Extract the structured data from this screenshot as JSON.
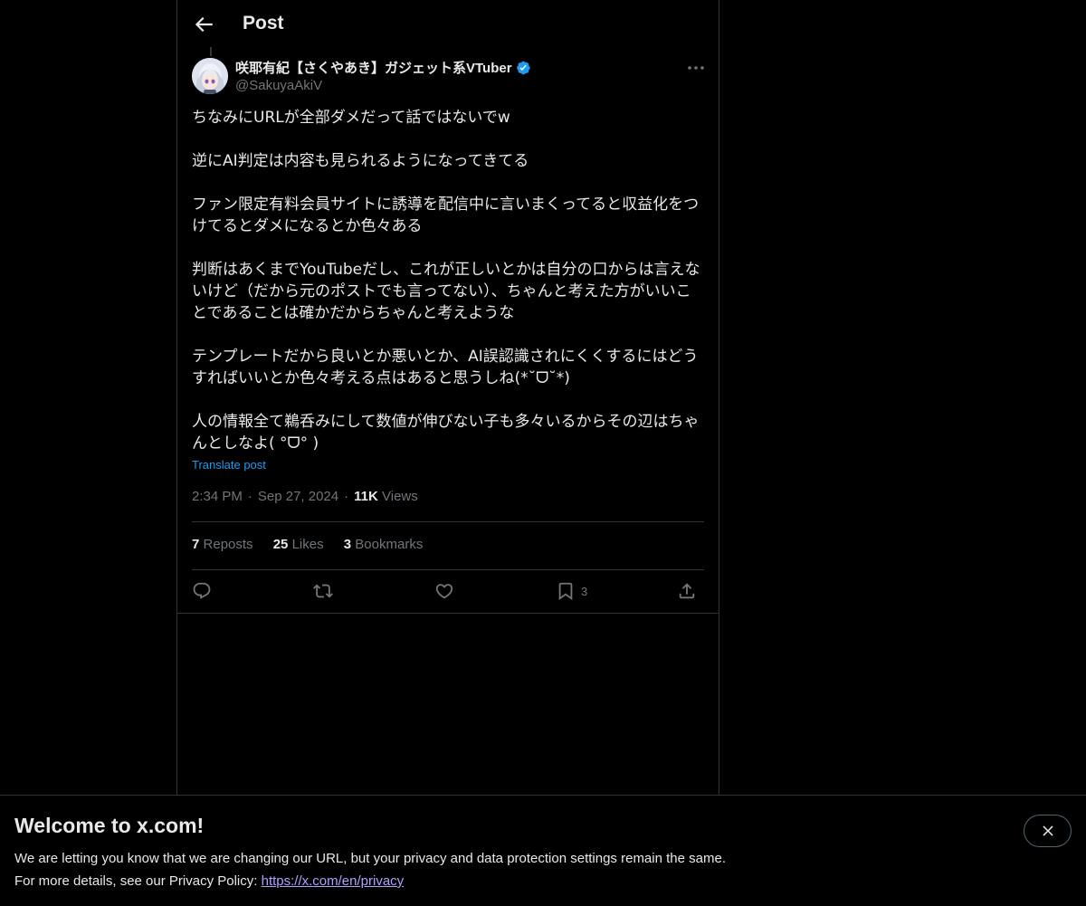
{
  "header": {
    "title": "Post"
  },
  "post": {
    "author_name": "咲耶有紀【さくやあき】ガジェット系VTuber",
    "handle": "@SakuyaAkiV",
    "paragraphs": [
      "ちなみにURLが全部ダメだって話ではないでw",
      "逆にAI判定は内容も見られるようになってきてる",
      "ファン限定有料会員サイトに誘導を配信中に言いまくってると収益化をつけてるとダメになるとか色々ある",
      "判断はあくまでYouTubeだし、これが正しいとかは自分の口からは言えないけど（だから元のポストでも言ってない）、ちゃんと考えた方がいいことであることは確かだからちゃんと考えような",
      "テンプレートだから良いとか悪いとか、AI誤認識されにくくするにはどうすればいいとか色々考える点はあると思うしね(*˘ᗜ˘*)",
      "人の情報全て鵜呑みにして数値が伸びない子も多々いるからその辺はちゃんとしなよ( °ᗜ° )"
    ],
    "translate_label": "Translate post",
    "time": "2:34 PM",
    "date": "Sep 27, 2024",
    "views_count": "11K",
    "views_label": "Views",
    "reposts_count": "7",
    "reposts_label": "Reposts",
    "likes_count": "25",
    "likes_label": "Likes",
    "bookmarks_count": "3",
    "bookmarks_label": "Bookmarks",
    "bookmark_action_count": "3"
  },
  "icons": {
    "back": "arrow-left-icon",
    "verified": "verified-badge-icon",
    "more": "more-horizontal-icon",
    "reply": "reply-icon",
    "repost": "repost-icon",
    "like": "heart-icon",
    "bookmark": "bookmark-icon",
    "share": "share-icon",
    "close": "close-icon"
  },
  "colors": {
    "background": "#000000",
    "text": "#e7e9ea",
    "muted": "#71767b",
    "accent": "#1d9bf0",
    "link": "#ada3ff",
    "border": "#2f3336"
  },
  "banner": {
    "title": "Welcome to x.com!",
    "line1": "We are letting you know that we are changing our URL, but your privacy and data protection settings remain the same.",
    "line2_prefix": "For more details, see our Privacy Policy:",
    "link": "https://x.com/en/privacy"
  }
}
